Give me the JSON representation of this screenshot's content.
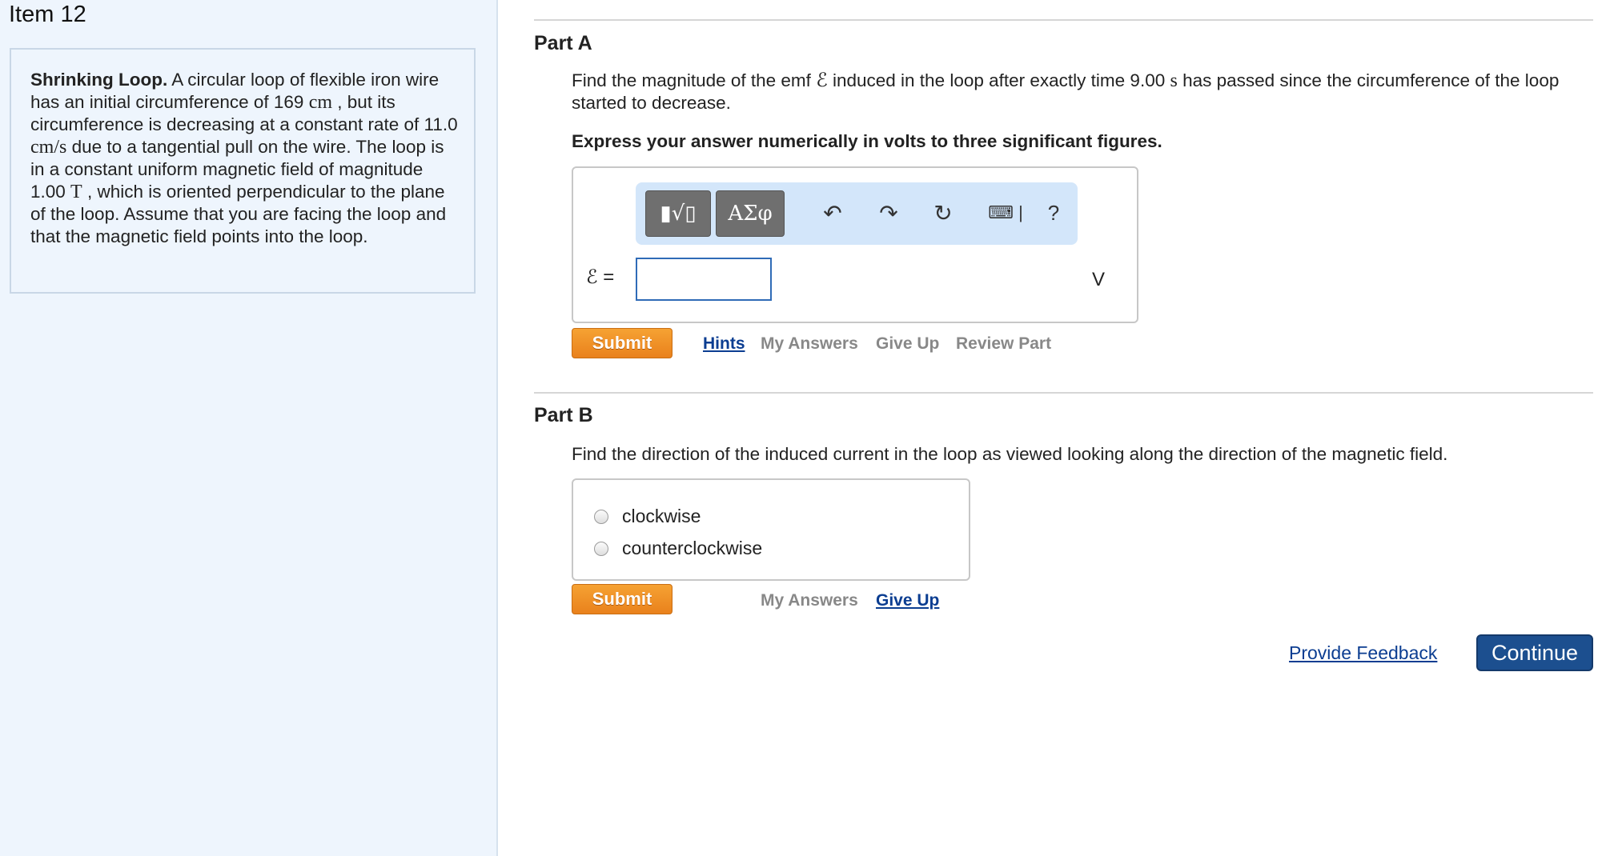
{
  "item": {
    "title": "Item 12"
  },
  "intro": {
    "heading": "Shrinking Loop.",
    "t1": " A circular loop of flexible iron wire has an initial circumference of 169 ",
    "u1": "cm",
    "t2": " , but its circumference is decreasing at a constant rate of 11.0 ",
    "u2": "cm/s",
    "t3": " due to a tangential pull on the wire. The loop is in a constant uniform magnetic field of magnitude 1.00 ",
    "u3": "T",
    "t4": " , which is oriented perpendicular to the plane of the loop. Assume that you are facing the loop and that the magnetic field points into the loop."
  },
  "part_a": {
    "label": "Part A",
    "q1": "Find the magnitude of the emf ",
    "emf_symbol": "ℰ",
    "q2": " induced in the loop after exactly time 9.00 ",
    "q_unit": "s",
    "q3": " has passed since the circumference of the loop started to decrease.",
    "instruction": "Express your answer numerically in volts to three significant figures.",
    "answer_label": "ℰ =",
    "answer_value": "",
    "unit": "V",
    "toolbar": {
      "templates": "▮√▯",
      "greek": "ΑΣφ",
      "undo": "↶",
      "redo": "↷",
      "reset": "↻",
      "keyboard": "⌨ |",
      "help": "?"
    },
    "submit": "Submit",
    "links": {
      "hints": "Hints",
      "my_answers": "My Answers",
      "give_up": "Give Up",
      "review_part": "Review Part"
    }
  },
  "part_b": {
    "label": "Part B",
    "question": "Find the direction of the induced current in the loop as viewed looking along the direction of the magnetic field.",
    "options": [
      "clockwise",
      "counterclockwise"
    ],
    "submit": "Submit",
    "links": {
      "my_answers": "My Answers",
      "give_up": "Give Up"
    }
  },
  "footer": {
    "feedback": "Provide Feedback",
    "continue": "Continue"
  }
}
